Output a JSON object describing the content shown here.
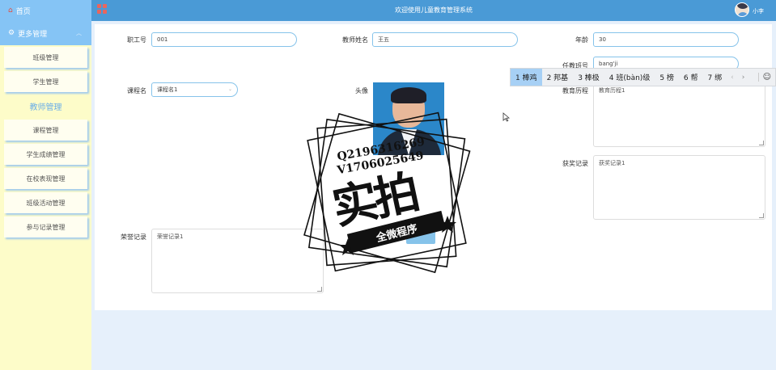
{
  "sidebar": {
    "home_label": "首页",
    "more_label": "更多管理",
    "items": [
      {
        "label": "班级管理"
      },
      {
        "label": "学生管理"
      },
      {
        "label": "教师管理"
      },
      {
        "label": "课程管理"
      },
      {
        "label": "学生成绩管理"
      },
      {
        "label": "在校表现管理"
      },
      {
        "label": "班级活动管理"
      },
      {
        "label": "参与记录管理"
      }
    ]
  },
  "header": {
    "title": "欢迎使用儿童教育管理系统",
    "username": "小李"
  },
  "form": {
    "staff_id": {
      "label": "职工号",
      "value": "001"
    },
    "teacher_name": {
      "label": "教师姓名",
      "value": "王五"
    },
    "age": {
      "label": "年龄",
      "value": "30"
    },
    "class_no": {
      "label": "任教班号",
      "value": "bang'ji"
    },
    "course": {
      "label": "课程名",
      "value": "课程名1"
    },
    "avatar": {
      "label": "头像"
    },
    "education": {
      "label": "教育历程",
      "value": "教育历程1"
    },
    "awards": {
      "label": "获奖记录",
      "value": "获奖记录1"
    },
    "honors": {
      "label": "荣誉记录",
      "value": "荣誉记录1"
    }
  },
  "ime": {
    "candidates": [
      "1 棒鸡",
      "2 邦基",
      "3 棒极",
      "4 班(bàn)级",
      "5 榜",
      "6 帮",
      "7 绑"
    ],
    "prev": "‹",
    "next": "›",
    "emoji": "☺"
  },
  "watermark": {
    "line1": "Q2196316269",
    "line2": "V1706025649",
    "main": "实拍",
    "ribbon": "全微程序"
  },
  "colors": {
    "topbar": "#4a9ad6",
    "sidebar_header": "#85c4f5",
    "sidebar_bg": "#fdfcc9",
    "input_border": "#86c3ea",
    "active_menu": "#6aaee8"
  }
}
